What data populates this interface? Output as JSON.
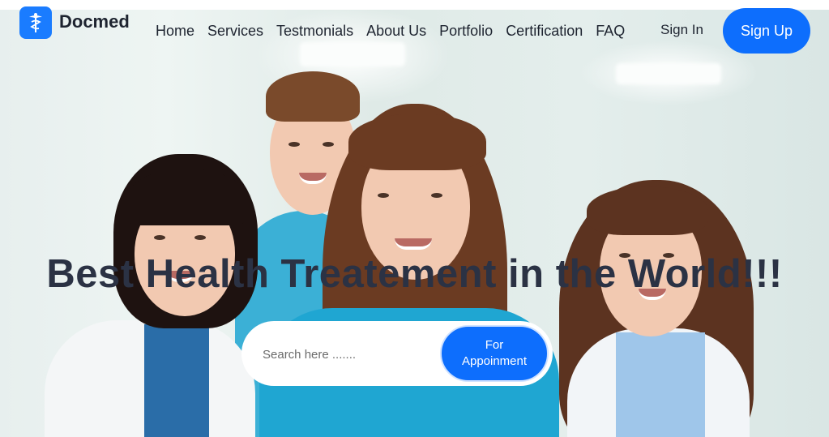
{
  "brand": {
    "name": "Docmed",
    "logo_icon": "caduceus-icon",
    "accent": "#0d6efd"
  },
  "nav": {
    "items": [
      {
        "label": "Home"
      },
      {
        "label": "Services"
      },
      {
        "label": "Testmonials"
      },
      {
        "label": "About Us"
      },
      {
        "label": "Portfolio"
      },
      {
        "label": "Certification"
      },
      {
        "label": "FAQ"
      }
    ],
    "signin_label": "Sign In",
    "signup_label": "Sign Up"
  },
  "hero": {
    "headline": "Best Health Treatement in the World!!!",
    "search": {
      "placeholder": "Search here ......."
    },
    "appointment_button": {
      "line1": "For",
      "line2": "Appoinment"
    }
  },
  "colors": {
    "headline": "#2b3244",
    "button": "#0d6efd",
    "text_dark": "#1e2430"
  }
}
